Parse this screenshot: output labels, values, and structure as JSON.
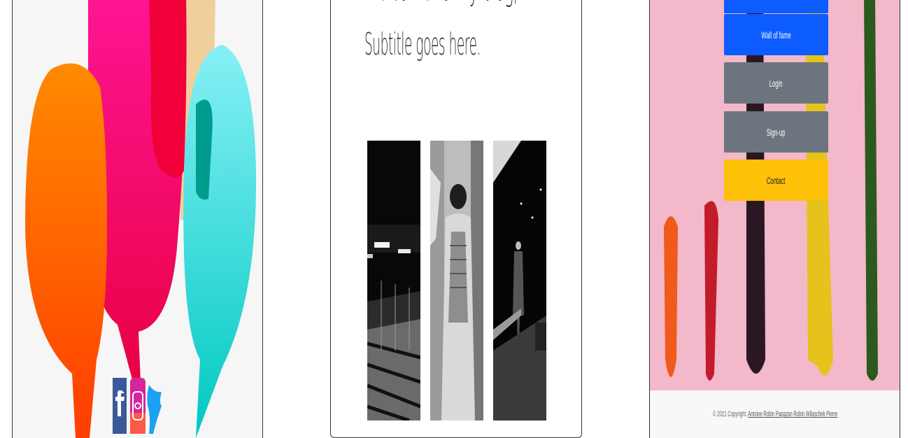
{
  "center": {
    "hero_title": "Welcome to my blog,",
    "subtitle": "Subtitle goes here."
  },
  "gallery": {
    "items": [
      {
        "icon": "parking-garage-photo"
      },
      {
        "icon": "portrait-photo"
      },
      {
        "icon": "street-night-photo"
      }
    ]
  },
  "social": {
    "icons": [
      "facebook-icon",
      "instagram-icon",
      "twitter-icon"
    ]
  },
  "menu": {
    "items": [
      {
        "label": "Wall of fame",
        "color": "#0d5cff"
      },
      {
        "label": "Login",
        "color": "#6c757d"
      },
      {
        "label": "Sign-up",
        "color": "#6c757d"
      },
      {
        "label": "Contact",
        "color": "#ffc107"
      }
    ],
    "top_partial_color": "#0d5cff"
  },
  "footer": {
    "prefix": "© 2021 Copyright:",
    "link": "Antoine Robin Pagazan Robin Wilaschek Pierre"
  },
  "colors": {
    "right_background": "#f3b8c9",
    "footer_background": "#f7f8fa"
  }
}
